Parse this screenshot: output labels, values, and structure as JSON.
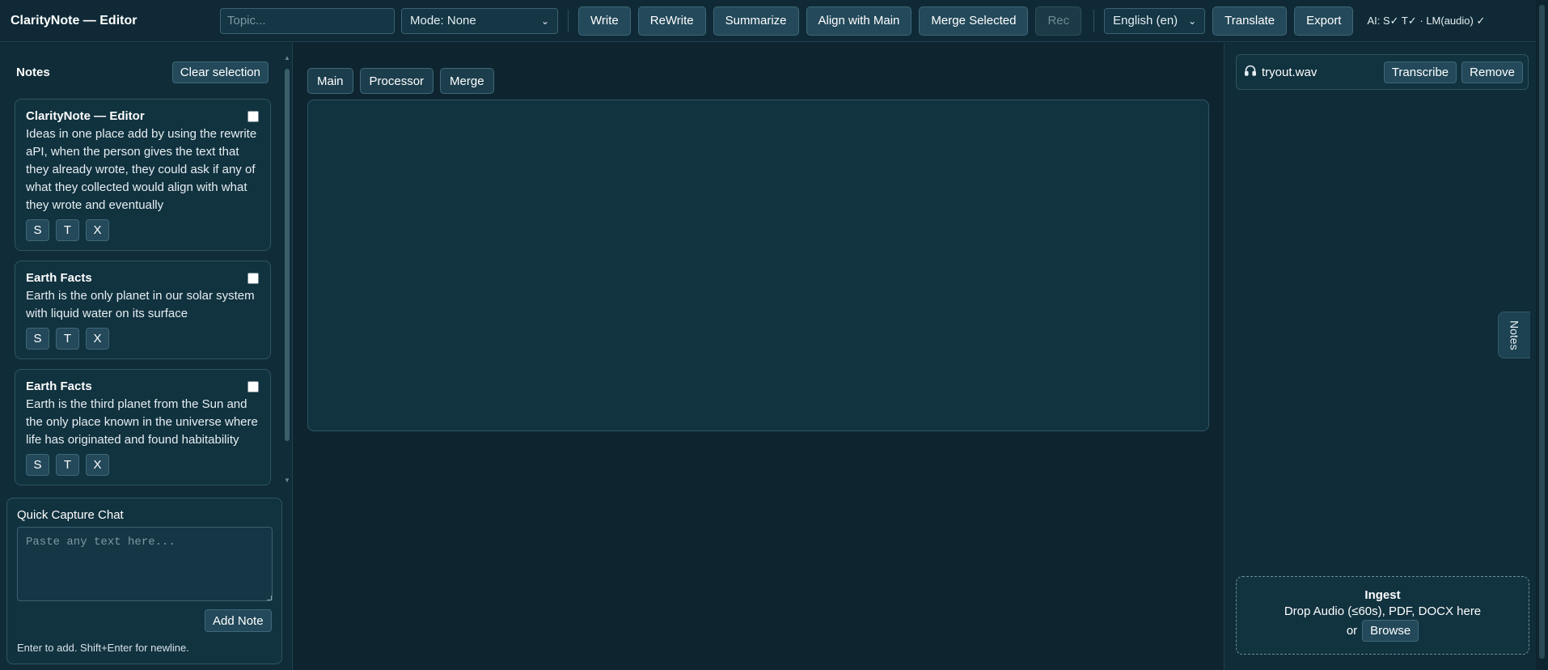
{
  "header": {
    "title": "ClarityNote — Editor",
    "topic_placeholder": "Topic...",
    "mode_value": "Mode: None",
    "buttons": {
      "write": "Write",
      "rewrite": "ReWrite",
      "summarize": "Summarize",
      "align": "Align with Main",
      "merge_selected": "Merge Selected",
      "rec": "Rec",
      "translate": "Translate",
      "export": "Export"
    },
    "language_value": "English (en)",
    "ai_status": "AI: S✓ T✓ · LM(audio) ✓"
  },
  "notes_panel": {
    "title": "Notes",
    "clear_label": "Clear selection",
    "notes": [
      {
        "title": "ClarityNote — Editor",
        "body": "Ideas in one place add by using the rewrite aPI, when the person gives the text that they already wrote, they could ask if any of what they collected would align with what they wrote and eventually",
        "actions": [
          "S",
          "T",
          "X"
        ]
      },
      {
        "title": "Earth Facts",
        "body": "Earth is the only planet in our solar system with liquid water on its surface",
        "actions": [
          "S",
          "T",
          "X"
        ]
      },
      {
        "title": "Earth Facts",
        "body": "Earth is the third planet from the Sun and the only place known in the universe where life has originated and found habitability",
        "actions": [
          "S",
          "T",
          "X"
        ]
      }
    ]
  },
  "quick_capture": {
    "title": "Quick Capture Chat",
    "placeholder": "Paste any text here...",
    "add_label": "Add Note",
    "hint": "Enter to add. Shift+Enter for newline."
  },
  "editor": {
    "tabs": [
      "Main",
      "Processor",
      "Merge"
    ]
  },
  "right_panel": {
    "audio_file": "tryout.wav",
    "transcribe_label": "Transcribe",
    "remove_label": "Remove",
    "ingest_title": "Ingest",
    "ingest_text": "Drop Audio (≤60s), PDF, DOCX here",
    "ingest_or": "or",
    "browse_label": "Browse",
    "notes_tab_label": "Notes"
  },
  "icons": {
    "audio": "headphones-icon",
    "dropdown": "chevron-down-icon"
  }
}
